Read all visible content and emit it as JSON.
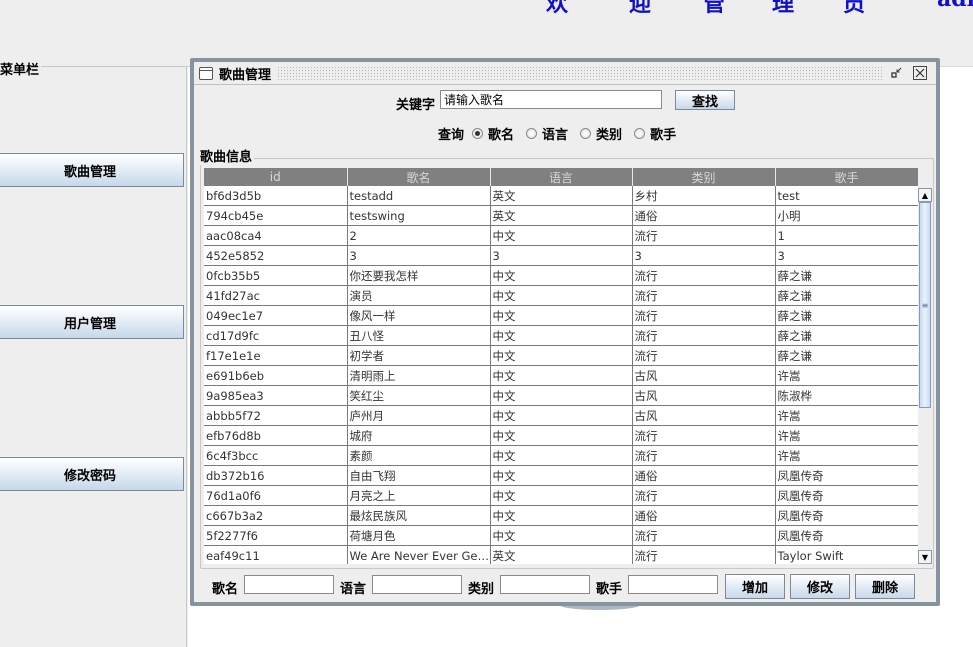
{
  "header": {
    "title_chars": [
      "欢",
      "迎",
      "管",
      "理",
      "员",
      "admin"
    ]
  },
  "sidebar": {
    "title": "菜单栏",
    "items": [
      {
        "label": "歌曲管理"
      },
      {
        "label": "用户管理"
      },
      {
        "label": "修改密码"
      }
    ]
  },
  "window": {
    "title": "歌曲管理",
    "restore_icon": "restore-icon",
    "close_icon": "close-icon"
  },
  "search": {
    "keyword_label": "关键字",
    "keyword_value": "请输入歌名",
    "find_button": "查找",
    "query_label": "查询",
    "options": [
      {
        "label": "歌名",
        "selected": true
      },
      {
        "label": "语言",
        "selected": false
      },
      {
        "label": "类别",
        "selected": false
      },
      {
        "label": "歌手",
        "selected": false
      }
    ]
  },
  "table": {
    "group_title": "歌曲信息",
    "columns": [
      "id",
      "歌名",
      "语言",
      "类别",
      "歌手"
    ],
    "rows": [
      [
        "bf6d3d5b",
        "testadd",
        "英文",
        "乡村",
        "test"
      ],
      [
        "794cb45e",
        "testswing",
        "英文",
        "通俗",
        "小明"
      ],
      [
        "aac08ca4",
        "2",
        "中文",
        "流行",
        "1"
      ],
      [
        "452e5852",
        "3",
        "3",
        "3",
        "3"
      ],
      [
        "0fcb35b5",
        "你还要我怎样",
        "中文",
        "流行",
        "薛之谦"
      ],
      [
        "41fd27ac",
        "演员",
        "中文",
        "流行",
        "薛之谦"
      ],
      [
        "049ec1e7",
        "像风一样",
        "中文",
        "流行",
        "薛之谦"
      ],
      [
        "cd17d9fc",
        "丑八怪",
        "中文",
        "流行",
        "薛之谦"
      ],
      [
        "f17e1e1e",
        "初学者",
        "中文",
        "流行",
        "薛之谦"
      ],
      [
        "e691b6eb",
        "清明雨上",
        "中文",
        "古风",
        "许嵩"
      ],
      [
        "9a985ea3",
        "笑红尘",
        "中文",
        "古风",
        "陈淑桦"
      ],
      [
        "abbb5f72",
        "庐州月",
        "中文",
        "古风",
        "许嵩"
      ],
      [
        "efb76d8b",
        "城府",
        "中文",
        "流行",
        "许嵩"
      ],
      [
        "6c4f3bcc",
        "素颜",
        "中文",
        "流行",
        "许嵩"
      ],
      [
        "db372b16",
        "自由飞翔",
        "中文",
        "通俗",
        "凤凰传奇"
      ],
      [
        "76d1a0f6",
        "月亮之上",
        "中文",
        "流行",
        "凤凰传奇"
      ],
      [
        "c667b3a2",
        "最炫民族风",
        "中文",
        "通俗",
        "凤凰传奇"
      ],
      [
        "5f2277f6",
        "荷塘月色",
        "中文",
        "流行",
        "凤凰传奇"
      ],
      [
        "eaf49c11",
        "We Are Never Ever Getti...",
        "英文",
        "流行",
        "Taylor Swift"
      ]
    ]
  },
  "form": {
    "fields": [
      {
        "label": "歌名",
        "value": ""
      },
      {
        "label": "语言",
        "value": ""
      },
      {
        "label": "类别",
        "value": ""
      },
      {
        "label": "歌手",
        "value": ""
      }
    ],
    "buttons": {
      "add": "增加",
      "edit": "修改",
      "delete": "删除"
    }
  },
  "colors": {
    "header_text": "#1010c8",
    "table_header_bg": "#808080",
    "frame_border": "#8794a0"
  }
}
